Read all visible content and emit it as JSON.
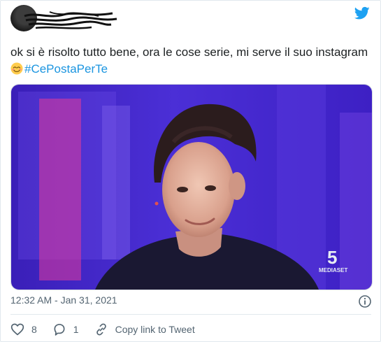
{
  "tweet": {
    "text": "ok si è risolto tutto bene, ora le cose serie, mi serve il suo instagram",
    "emoji": "smiling-face-emoji",
    "hashtag": "#CePostaPerTe",
    "timestamp": "12:32 AM - Jan 31, 2021",
    "media_watermark": "5",
    "media_watermark_brand": "MEDIASET"
  },
  "actions": {
    "like_count": "8",
    "reply_count": "1",
    "copy_link_label": "Copy link to Tweet"
  },
  "colors": {
    "brand": "#1da1f2",
    "hashtag": "#1b95e0",
    "muted_text": "#536471",
    "border": "#e1e8ed"
  }
}
